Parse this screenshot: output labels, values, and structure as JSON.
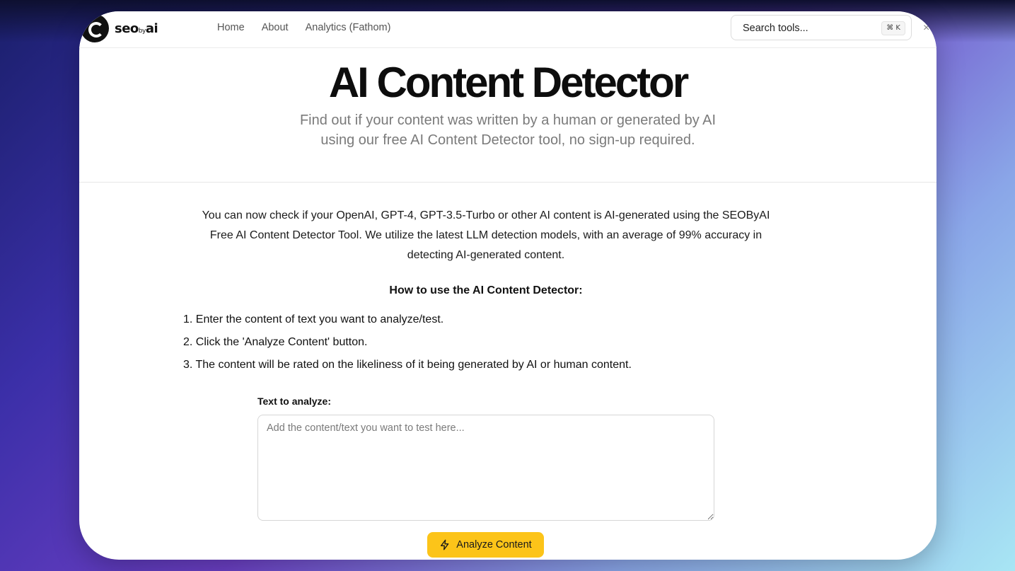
{
  "nav": {
    "logo_text": "seo",
    "logo_small": "by",
    "logo_text2": "ai",
    "links": [
      "Home",
      "About",
      "Analytics (Fathom)"
    ],
    "search_label": "Search tools...",
    "search_shortcut": "⌘ K",
    "close": "×"
  },
  "hero": {
    "title": "AI Content Detector",
    "subtitle": "Find out if your content was written by a human or generated by AI using our free AI Content Detector tool, no sign-up required."
  },
  "intro": "You can now check if your OpenAI, GPT-4, GPT-3.5-Turbo or other AI content is AI-generated using the SEOByAI Free AI Content Detector Tool. We utilize the latest LLM detection models, with an average of 99% accuracy in detecting AI-generated content.",
  "howto": {
    "title": "How to use the AI Content Detector:",
    "steps": [
      "1. Enter the content of text you want to analyze/test.",
      "2. Click the 'Analyze Content' button.",
      "3. The content will be rated on the likeliness of it being generated by AI or human content."
    ]
  },
  "form": {
    "label": "Text to analyze:",
    "placeholder": "Add the content/text you want to test here...",
    "value": "",
    "button_label": "Analyze Content",
    "button_icon": "bolt-icon",
    "button_color": "#fcc419"
  }
}
